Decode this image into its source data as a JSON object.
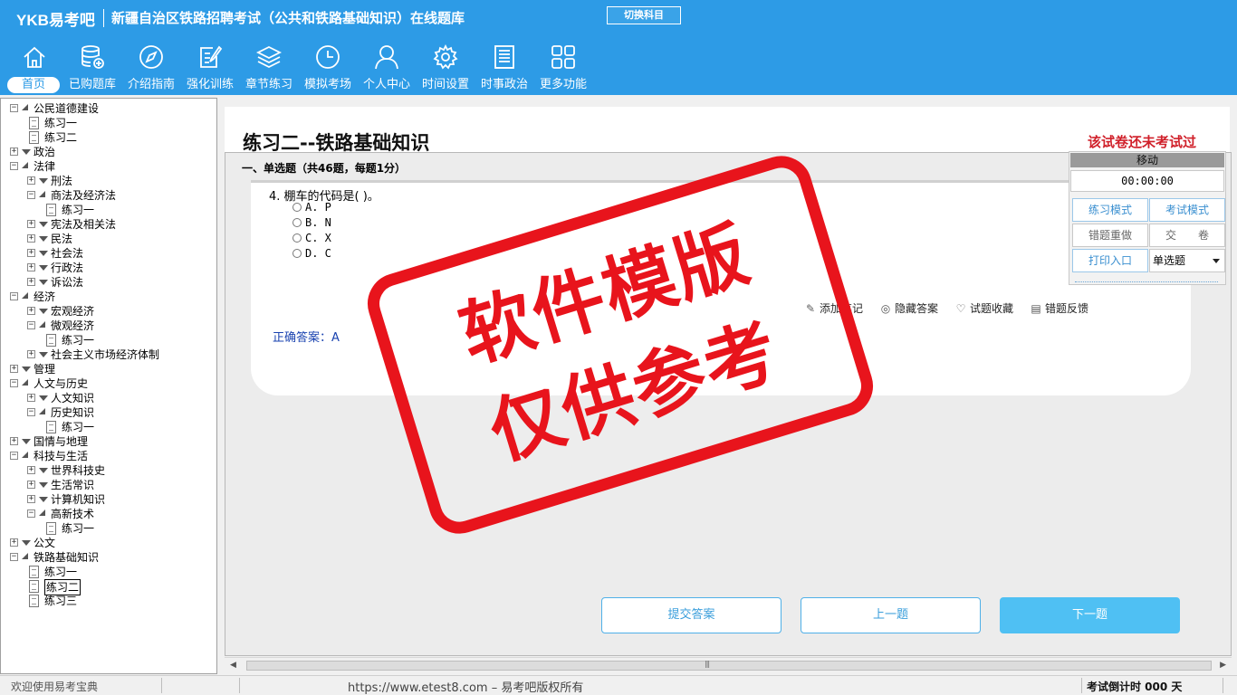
{
  "header": {
    "logo": "YKB易考吧",
    "title": "新疆自治区铁路招聘考试（公共和铁路基础知识）在线题库",
    "switch_label": "切换科目"
  },
  "nav": [
    {
      "label": "首页",
      "icon": "home-icon"
    },
    {
      "label": "已购题库",
      "icon": "database-icon"
    },
    {
      "label": "介绍指南",
      "icon": "compass-icon"
    },
    {
      "label": "强化训练",
      "icon": "edit-icon"
    },
    {
      "label": "章节练习",
      "icon": "layers-icon"
    },
    {
      "label": "模拟考场",
      "icon": "clock-icon"
    },
    {
      "label": "个人中心",
      "icon": "user-icon"
    },
    {
      "label": "时间设置",
      "icon": "gear-icon"
    },
    {
      "label": "时事政治",
      "icon": "news-icon"
    },
    {
      "label": "更多功能",
      "icon": "grid-icon"
    }
  ],
  "tree": [
    {
      "label": "公民道德建设",
      "level": 0,
      "kind": "folder",
      "open": true
    },
    {
      "label": "练习一",
      "level": 1,
      "kind": "doc"
    },
    {
      "label": "练习二",
      "level": 1,
      "kind": "doc"
    },
    {
      "label": "政治",
      "level": 0,
      "kind": "folder",
      "open": false
    },
    {
      "label": "法律",
      "level": 0,
      "kind": "folder",
      "open": true
    },
    {
      "label": "刑法",
      "level": 1,
      "kind": "folder",
      "open": false
    },
    {
      "label": "商法及经济法",
      "level": 1,
      "kind": "folder",
      "open": true
    },
    {
      "label": "练习一",
      "level": 2,
      "kind": "doc"
    },
    {
      "label": "宪法及相关法",
      "level": 1,
      "kind": "folder",
      "open": false
    },
    {
      "label": "民法",
      "level": 1,
      "kind": "folder",
      "open": false
    },
    {
      "label": "社会法",
      "level": 1,
      "kind": "folder",
      "open": false
    },
    {
      "label": "行政法",
      "level": 1,
      "kind": "folder",
      "open": false
    },
    {
      "label": "诉讼法",
      "level": 1,
      "kind": "folder",
      "open": false
    },
    {
      "label": "经济",
      "level": 0,
      "kind": "folder",
      "open": true
    },
    {
      "label": "宏观经济",
      "level": 1,
      "kind": "folder",
      "open": false
    },
    {
      "label": "微观经济",
      "level": 1,
      "kind": "folder",
      "open": true
    },
    {
      "label": "练习一",
      "level": 2,
      "kind": "doc"
    },
    {
      "label": "社会主义市场经济体制",
      "level": 1,
      "kind": "folder",
      "open": false
    },
    {
      "label": "管理",
      "level": 0,
      "kind": "folder",
      "open": false
    },
    {
      "label": "人文与历史",
      "level": 0,
      "kind": "folder",
      "open": true
    },
    {
      "label": "人文知识",
      "level": 1,
      "kind": "folder",
      "open": false
    },
    {
      "label": "历史知识",
      "level": 1,
      "kind": "folder",
      "open": true
    },
    {
      "label": "练习一",
      "level": 2,
      "kind": "doc"
    },
    {
      "label": "国情与地理",
      "level": 0,
      "kind": "folder",
      "open": false
    },
    {
      "label": "科技与生活",
      "level": 0,
      "kind": "folder",
      "open": true
    },
    {
      "label": "世界科技史",
      "level": 1,
      "kind": "folder",
      "open": false
    },
    {
      "label": "生活常识",
      "level": 1,
      "kind": "folder",
      "open": false
    },
    {
      "label": "计算机知识",
      "level": 1,
      "kind": "folder",
      "open": false
    },
    {
      "label": "高新技术",
      "level": 1,
      "kind": "folder",
      "open": true
    },
    {
      "label": "练习一",
      "level": 2,
      "kind": "doc"
    },
    {
      "label": "公文",
      "level": 0,
      "kind": "folder",
      "open": false
    },
    {
      "label": "铁路基础知识",
      "level": 0,
      "kind": "folder",
      "open": true
    },
    {
      "label": "练习一",
      "level": 1,
      "kind": "doc"
    },
    {
      "label": "练习二",
      "level": 1,
      "kind": "doc",
      "selected": true
    },
    {
      "label": "练习三",
      "level": 1,
      "kind": "doc"
    }
  ],
  "main": {
    "paper_title": "练习二--铁路基础知识",
    "exam_status": "该试卷还未考试过",
    "section_title": "一、单选题（共46题，每题1分）",
    "question": "4. 棚车的代码是( )。",
    "options": [
      "A. P",
      "B. N",
      "C. X",
      "D. C"
    ],
    "actions": [
      {
        "label": "添加笔记",
        "icon": "pencil-icon"
      },
      {
        "label": "隐藏答案",
        "icon": "eye-icon"
      },
      {
        "label": "试题收藏",
        "icon": "heart-icon"
      },
      {
        "label": "错题反馈",
        "icon": "feedback-icon"
      }
    ],
    "answer_label": "正确答案：",
    "answer_value": "A",
    "submit_label": "提交答案",
    "prev_label": "上一题",
    "next_label": "下一题"
  },
  "panel": {
    "move_label": "移动",
    "timer": "00:00:00",
    "practice_mode": "练习模式",
    "exam_mode": "考试模式",
    "redo_wrong": "错题重做",
    "hand_in": "交　　卷",
    "print": "打印入口",
    "type_selected": "单选题"
  },
  "stamp": {
    "line1": "软件模版",
    "line2": "仅供参考"
  },
  "status": {
    "welcome": "欢迎使用易考宝典",
    "copyright": "https://www.etest8.com – 易考吧版权所有",
    "countdown": "考试倒计时 000 天"
  },
  "colors": {
    "header_bg": "#2d9be6",
    "accent": "#3a9edb",
    "status_red": "#d0202a",
    "stamp_red": "#e8141c"
  }
}
